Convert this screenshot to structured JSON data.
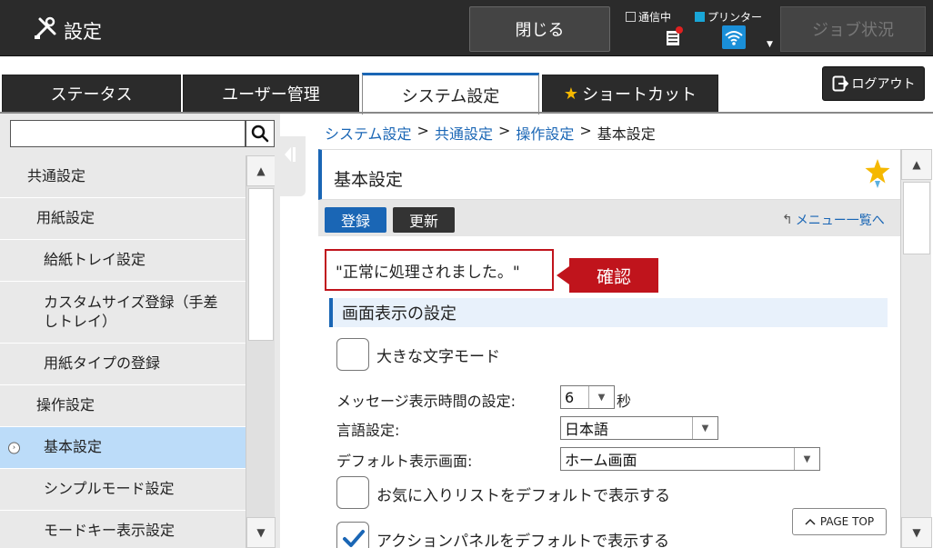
{
  "header": {
    "title": "設定",
    "close_label": "閉じる",
    "comm_label": "通信中",
    "printer_label": "プリンター",
    "job_label": "ジョブ状況",
    "logout_label": "ログアウト"
  },
  "tabs": [
    {
      "label": "ステータス",
      "active": false
    },
    {
      "label": "ユーザー管理",
      "active": false
    },
    {
      "label": "システム設定",
      "active": true
    },
    {
      "label": "ショートカット",
      "active": false
    }
  ],
  "sidebar": {
    "search_value": "",
    "items": [
      {
        "label": "共通設定",
        "level": 1
      },
      {
        "label": "用紙設定",
        "level": 2
      },
      {
        "label": "給紙トレイ設定",
        "level": 3
      },
      {
        "label": "カスタムサイズ登録（手差しトレイ）",
        "level": 3
      },
      {
        "label": "用紙タイプの登録",
        "level": 3
      },
      {
        "label": "操作設定",
        "level": 2
      },
      {
        "label": "基本設定",
        "level": 3,
        "selected": true
      },
      {
        "label": "シンプルモード設定",
        "level": 3
      },
      {
        "label": "モードキー表示設定",
        "level": 3
      }
    ]
  },
  "breadcrumb": {
    "items": [
      "システム設定",
      "共通設定",
      "操作設定"
    ],
    "current": "基本設定",
    "separator": ">"
  },
  "main": {
    "title": "基本設定",
    "register_label": "登録",
    "update_label": "更新",
    "menu_link_label": "メニュー一覧へ",
    "message": "\"正常に処理されました。\"",
    "confirm_label": "確認",
    "section_title": "画面表示の設定",
    "large_text_label": "大きな文字モード",
    "large_text_checked": false,
    "msg_time_label": "メッセージ表示時間の設定:",
    "msg_time_value": "6",
    "msg_time_unit": "秒",
    "language_label": "言語設定:",
    "language_value": "日本語",
    "default_screen_label": "デフォルト表示画面:",
    "default_screen_value": "ホーム画面",
    "favorites_label": "お気に入りリストをデフォルトで表示する",
    "favorites_checked": false,
    "action_panel_label": "アクションパネルをデフォルトで表示する",
    "action_panel_checked": true,
    "page_top_label": "PAGE TOP"
  },
  "colors": {
    "accent": "#1a66b5",
    "confirm": "#c0141c",
    "selected_bg": "#bcdcf9",
    "star": "#f5b800"
  }
}
